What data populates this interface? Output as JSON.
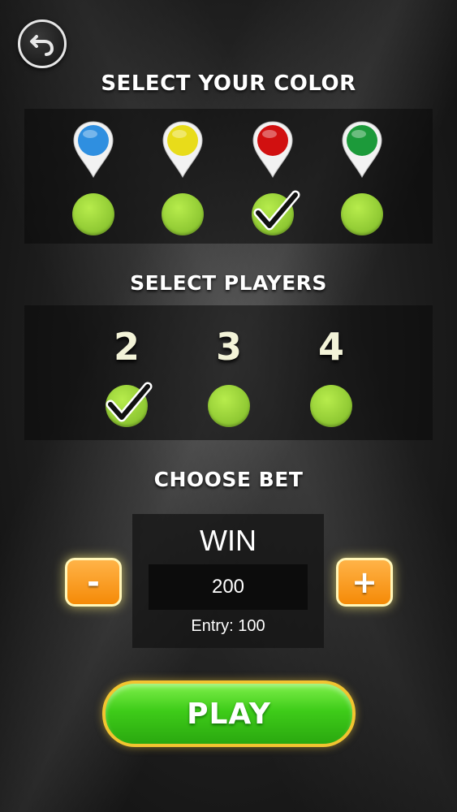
{
  "back": {
    "icon": "undo-arrow-icon"
  },
  "color_section": {
    "title": "SELECT YOUR COLOR",
    "options": [
      {
        "name": "blue",
        "color": "#2f8fe0",
        "selected": false
      },
      {
        "name": "yellow",
        "color": "#e8dc1a",
        "selected": false
      },
      {
        "name": "red",
        "color": "#d11010",
        "selected": true
      },
      {
        "name": "green",
        "color": "#1c9a3a",
        "selected": false
      }
    ]
  },
  "players_section": {
    "title": "SELECT PLAYERS",
    "options": [
      {
        "label": "2",
        "selected": true
      },
      {
        "label": "3",
        "selected": false
      },
      {
        "label": "4",
        "selected": false
      }
    ]
  },
  "bet_section": {
    "title": "CHOOSE BET",
    "win_label": "WIN",
    "win_value": "200",
    "entry_text": "Entry: 100",
    "minus_label": "-",
    "plus_label": "+"
  },
  "play_button": {
    "label": "PLAY"
  },
  "colors": {
    "selector_green": "#8cc631",
    "button_orange": "#f58a07",
    "play_green": "#3ecc19",
    "play_border": "#f2c430"
  }
}
